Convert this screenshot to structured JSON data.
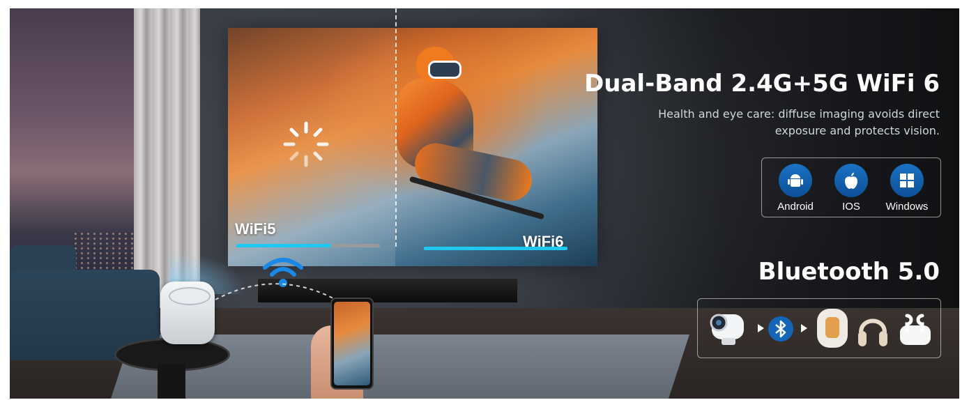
{
  "headline": "Dual-Band 2.4G+5G WiFi 6",
  "subline": "Health and eye care: diffuse imaging avoids direct exposure and protects vision.",
  "screen": {
    "left_label": "WiFi5",
    "right_label": "WiFi6",
    "wifi5_progress": 0.66,
    "wifi6_progress": 1.0
  },
  "os": [
    {
      "label": "Android",
      "icon": "android-icon"
    },
    {
      "label": "IOS",
      "icon": "apple-icon"
    },
    {
      "label": "Windows",
      "icon": "windows-icon"
    }
  ],
  "bluetooth_title": "Bluetooth 5.0",
  "bluetooth_chain": [
    "projector-icon",
    "bluetooth-icon",
    "smart-speaker-icon",
    "headphones-icon",
    "earbuds-icon"
  ],
  "colors": {
    "accent_cyan": "#1ec8f0",
    "os_blue": "#1566b8",
    "skier_orange": "#f07a20"
  }
}
